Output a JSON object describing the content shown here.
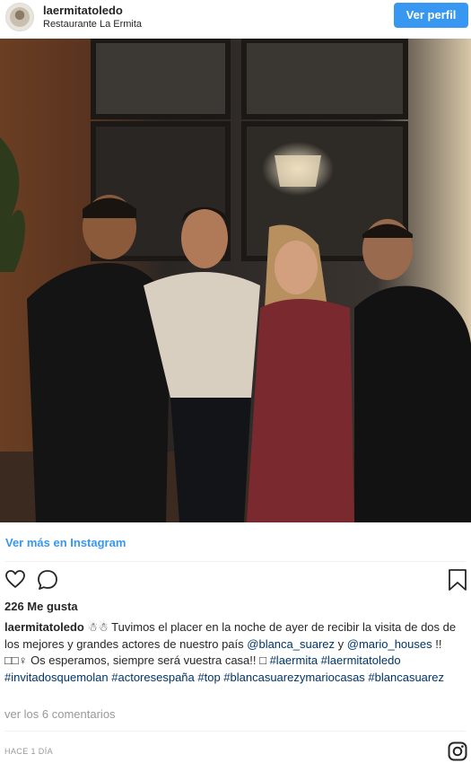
{
  "header": {
    "username": "laermitatoledo",
    "location": "Restaurante La Ermita",
    "profile_button": "Ver perfil",
    "button_color": "#3897f0"
  },
  "post": {
    "image_alt": "Cuatro personas posando en un restaurante"
  },
  "more_link": "Ver más en Instagram",
  "actions": {
    "like_icon": "heart-icon",
    "comment_icon": "comment-icon",
    "save_icon": "bookmark-icon"
  },
  "likes": "226 Me gusta",
  "caption": {
    "user": "laermitatoledo",
    "part1": " ☃☃ Tuvimos el placer en la noche de ayer de recibir la visita de dos de los mejores y grandes actores de nuestro país ",
    "mention1": "@blanca_suarez",
    "part2": " y ",
    "mention2": "@mario_houses",
    "part3": " !! □□♀ Os esperamos, siempre será vuestra casa!! □ ",
    "hashtags": "#laermita #laermitatoledo #invitadosquemolan #actoresespaña #top #blancasuarezymariocasas #blancasuarez"
  },
  "comments_link": "ver los 6 comentarios",
  "timestamp": "HACE 1 DÍA",
  "footer_icon": "instagram-icon"
}
